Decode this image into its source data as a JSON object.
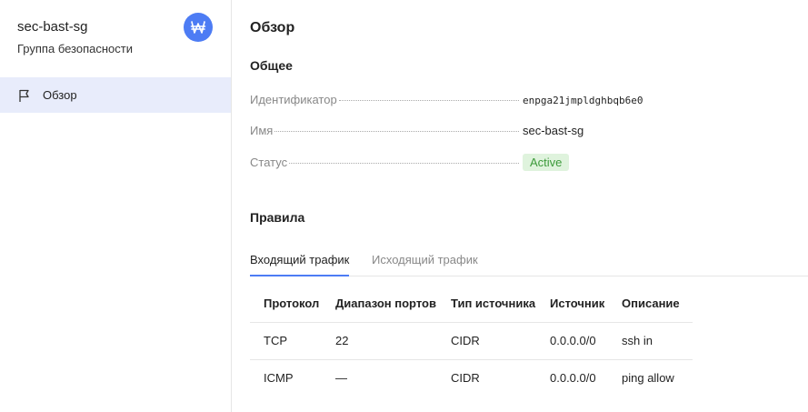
{
  "sidebar": {
    "title": "sec-bast-sg",
    "subtitle": "Группа безопасности",
    "avatar_icon": "security-group-icon",
    "nav": [
      {
        "label": "Обзор",
        "icon": "flag-icon",
        "active": true
      }
    ]
  },
  "main": {
    "page_title": "Обзор",
    "general": {
      "title": "Общее",
      "id_label": "Идентификатор",
      "id_value": "enpga21jmpldghbqb6e0",
      "name_label": "Имя",
      "name_value": "sec-bast-sg",
      "status_label": "Статус",
      "status_value": "Active"
    },
    "rules": {
      "title": "Правила",
      "tabs": [
        {
          "label": "Входящий трафик",
          "active": true
        },
        {
          "label": "Исходящий трафик",
          "active": false
        }
      ],
      "columns": [
        "Протокол",
        "Диапазон портов",
        "Тип источника",
        "Источник",
        "Описание"
      ],
      "rows": [
        [
          "TCP",
          "22",
          "CIDR",
          "0.0.0.0/0",
          "ssh in"
        ],
        [
          "ICMP",
          "—",
          "CIDR",
          "0.0.0.0/0",
          "ping allow"
        ]
      ]
    }
  },
  "colors": {
    "accent": "#4d7cf4",
    "nav_active_bg": "#e8ecfb",
    "status_bg": "#dff3dd",
    "status_text": "#3c9a3a"
  }
}
